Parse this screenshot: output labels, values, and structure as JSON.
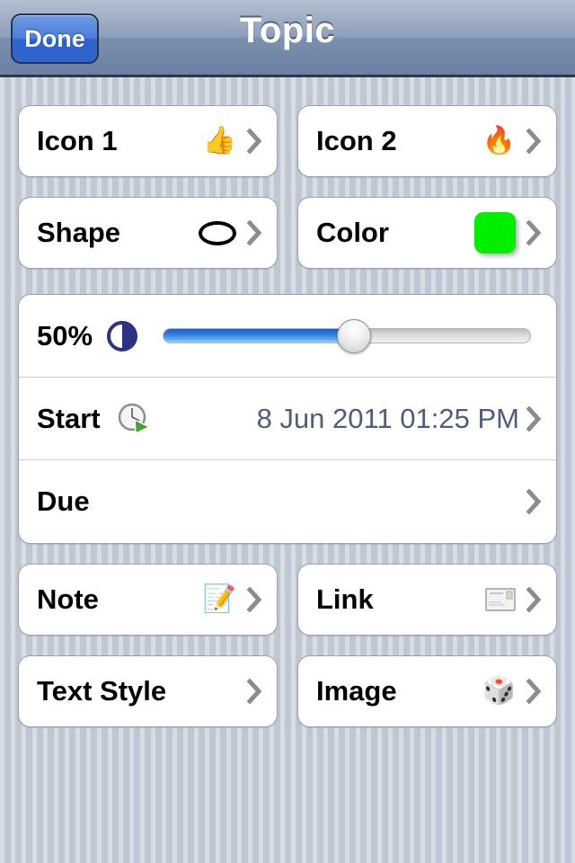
{
  "navbar": {
    "title": "Topic",
    "done_label": "Done"
  },
  "sections": [
    {
      "layout": "pair",
      "rows": [
        {
          "label": "Icon 1",
          "icon": "thumbs-up-emoji",
          "glyph": "👍",
          "value": ""
        },
        {
          "label": "Icon 2",
          "icon": "fire-emoji",
          "glyph": "🔥",
          "value": ""
        }
      ]
    },
    {
      "layout": "pair",
      "rows": [
        {
          "label": "Shape",
          "icon": "ellipse-shape-icon",
          "glyph": "",
          "value": ""
        },
        {
          "label": "Color",
          "icon": "color-swatch-icon",
          "glyph": "",
          "value": "",
          "color": "#00ee00"
        }
      ]
    },
    {
      "layout": "full",
      "rows": [
        {
          "label": "50%",
          "icon": "contrast-half-circle-icon",
          "glyph": "",
          "value": "",
          "slider_percent": 50
        },
        {
          "label": "Start",
          "icon": "clock-play-icon",
          "glyph": "",
          "value": "8 Jun 2011 01:25 PM"
        },
        {
          "label": "Due",
          "icon": "",
          "glyph": "",
          "value": ""
        }
      ]
    },
    {
      "layout": "pair",
      "rows": [
        {
          "label": "Note",
          "icon": "memo-pencil-emoji",
          "glyph": "📝",
          "value": ""
        },
        {
          "label": "Link",
          "icon": "envelope-card-icon",
          "glyph": "✉",
          "value": ""
        }
      ]
    },
    {
      "layout": "pair",
      "rows": [
        {
          "label": "Text Style",
          "icon": "",
          "glyph": "",
          "value": ""
        },
        {
          "label": "Image",
          "icon": "dice-emoji",
          "glyph": "🎲",
          "value": ""
        }
      ]
    }
  ],
  "colors": {
    "accent_blue": "#2f63cd",
    "swatch_green": "#00ee00",
    "value_text": "#4c5e80",
    "chevron_gray": "#8c8c8c",
    "contrast_navy": "#2d3287"
  }
}
